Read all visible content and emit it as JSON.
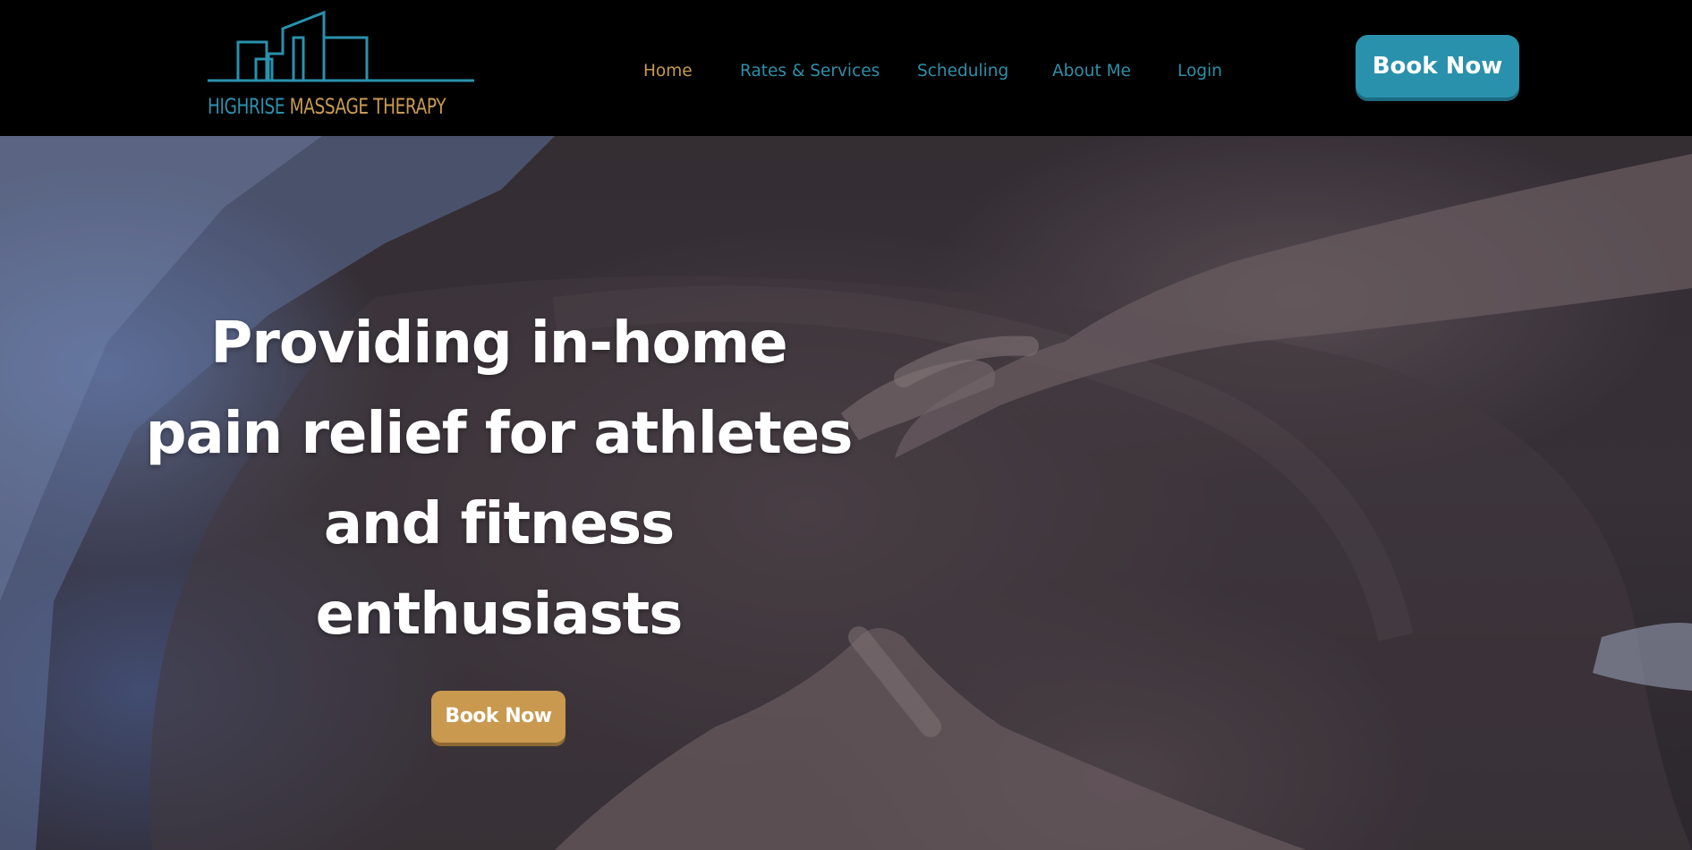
{
  "brand": {
    "logo_word_1": "HIGHRISE",
    "logo_word_2": "MASSAGE THERAPY",
    "logo_icon": "city-skyline-icon",
    "color_blue": "#2a91ad",
    "color_gold": "#c99b52"
  },
  "nav": {
    "items": [
      {
        "label": "Home",
        "active": true
      },
      {
        "label": "Rates & Services",
        "active": false
      },
      {
        "label": "Scheduling",
        "active": false
      },
      {
        "label": "About Me",
        "active": false
      },
      {
        "label": "Login",
        "active": false
      }
    ],
    "active_color": "#c8994f",
    "link_color": "#2f8fa9"
  },
  "header": {
    "cta_label": "Book Now"
  },
  "hero": {
    "title_lines": [
      "Providing in-home",
      "pain relief for athletes",
      "and fitness",
      "enthusiasts"
    ],
    "cta_label": "Book Now",
    "background_image": "massage-hands-on-back-photo"
  }
}
